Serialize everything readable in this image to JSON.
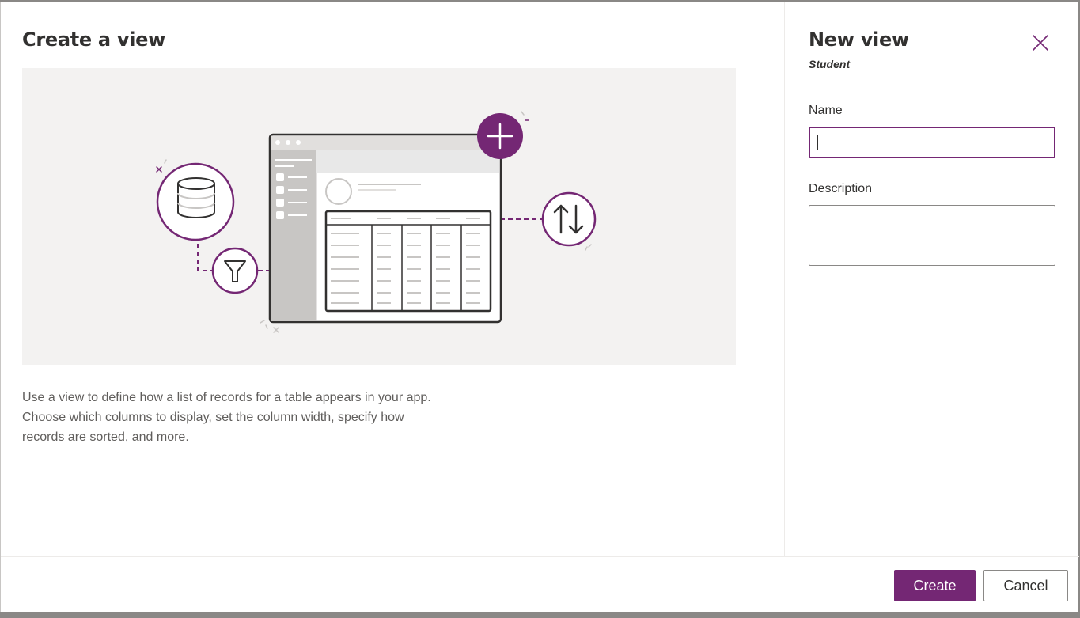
{
  "dialog": {
    "left_title": "Create a view",
    "description": "Use a view to define how a list of records for a table appears in your app. Choose which columns to display, set the column width, specify how records are sorted, and more.",
    "illustration_icons": [
      "database-icon",
      "filter-icon",
      "sort-icon",
      "plus-icon",
      "app-window-icon"
    ]
  },
  "panel": {
    "title": "New view",
    "subtitle": "Student",
    "name_label": "Name",
    "name_value": "",
    "description_label": "Description",
    "description_value": "",
    "close_icon": "close-icon"
  },
  "footer": {
    "create_label": "Create",
    "cancel_label": "Cancel"
  },
  "colors": {
    "accent": "#742774",
    "illustration_bg": "#f3f2f1",
    "text": "#323130",
    "muted_text": "#605e5c"
  }
}
